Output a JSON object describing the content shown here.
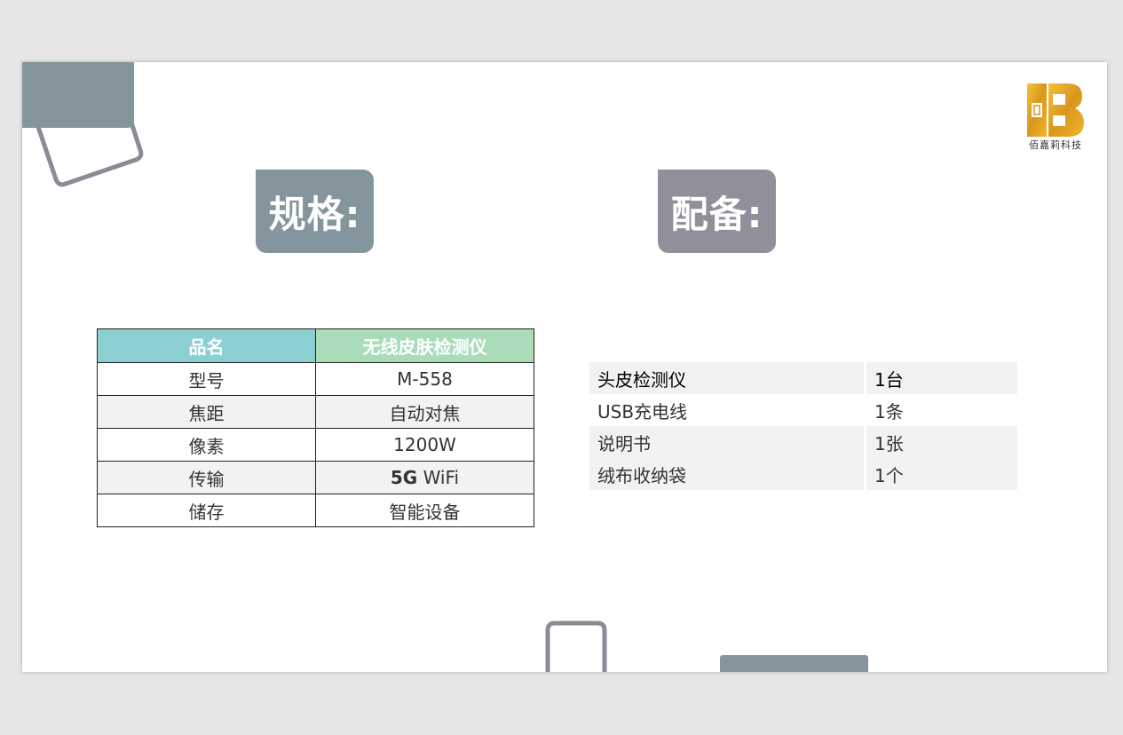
{
  "colors": {
    "spec_heading_bg": "#85959e",
    "accessory_heading_bg": "#918f99",
    "table_header_col1": "#8ccfd3",
    "table_header_col2": "#aadcba",
    "logo_gold": "#e3a21a"
  },
  "logo": {
    "icon": "bjl-gold-logo",
    "text": "佰嘉莉科技"
  },
  "spec": {
    "heading": "规格:",
    "header": [
      "品名",
      "无线皮肤检测仪"
    ],
    "rows": [
      {
        "label": "型号",
        "value": "M-558"
      },
      {
        "label": "焦距",
        "value": "自动对焦"
      },
      {
        "label": "像素",
        "value": "1200W"
      },
      {
        "label": "传输",
        "value_bold": "5G",
        "value": " WiFi"
      },
      {
        "label": "储存",
        "value": "智能设备"
      }
    ]
  },
  "accessories": {
    "heading": "配备:",
    "rows": [
      {
        "name": "头皮检测仪",
        "qty": "1台"
      },
      {
        "name": "USB充电线",
        "qty": "1条"
      },
      {
        "name": "说明书",
        "qty": "1张"
      },
      {
        "name": "绒布收纳袋",
        "qty": "1个"
      }
    ]
  }
}
